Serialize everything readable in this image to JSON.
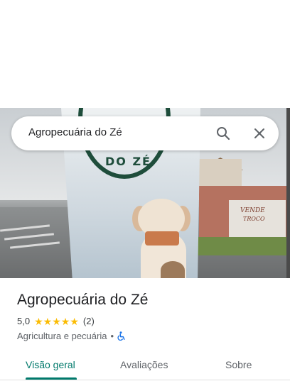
{
  "search": {
    "query": "Agropecuária do Zé"
  },
  "photo": {
    "banner_logo_text": "DO ZÉ",
    "wall_text_1": "VENDE",
    "wall_text_2": "TROCO"
  },
  "place": {
    "name": "Agropecuária do Zé",
    "rating": "5,0",
    "stars": 5,
    "review_count": "(2)",
    "category": "Agricultura e pecuária",
    "separator": "•"
  },
  "tabs": [
    {
      "label": "Visão geral",
      "active": true
    },
    {
      "label": "Avaliações",
      "active": false
    },
    {
      "label": "Sobre",
      "active": false
    }
  ],
  "colors": {
    "accent": "#00796b",
    "star": "#fbbc04",
    "accessibility": "#1a73e8"
  },
  "icons": {
    "search": "search-icon",
    "close": "close-icon",
    "accessibility": "wheelchair-icon"
  }
}
